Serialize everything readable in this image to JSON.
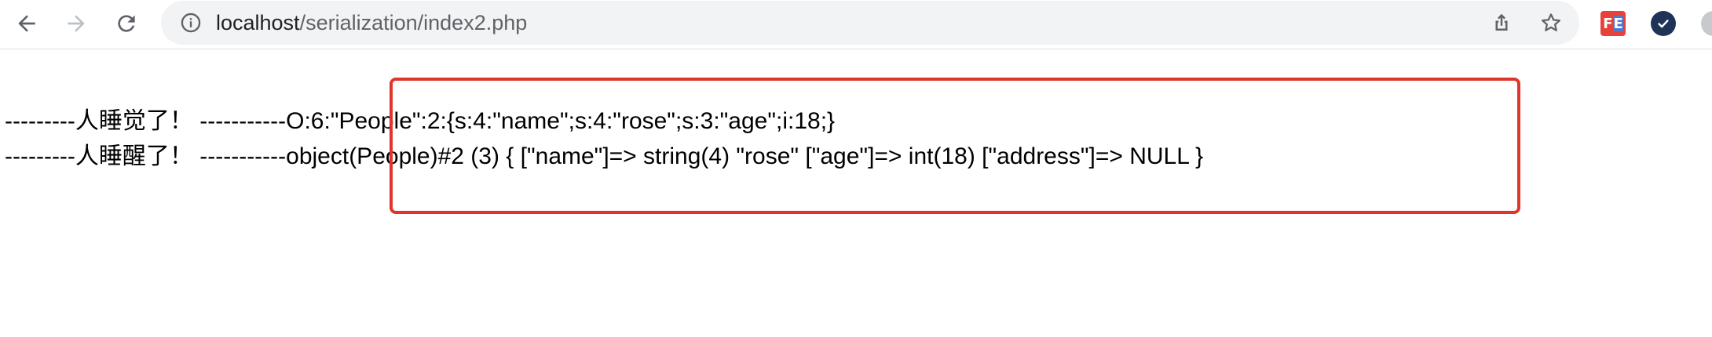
{
  "browser": {
    "url_host": "localhost",
    "url_path": "/serialization/index2.php",
    "icons": {
      "back": "arrow-left-icon",
      "forward": "arrow-right-icon",
      "reload": "reload-icon",
      "site_info": "info-icon",
      "share": "share-icon",
      "bookmark": "star-icon"
    },
    "extensions": [
      {
        "name": "fe-helper",
        "label_f": "F",
        "label_e": "E",
        "color": "#e8413a"
      },
      {
        "name": "check-extension",
        "color": "#1f3358"
      }
    ]
  },
  "page": {
    "line1_prefix": "---------人睡觉了！ -----------",
    "line1_value": "O:6:\"People\":2:{s:4:\"name\";s:4:\"rose\";s:3:\"age\";i:18;}",
    "line2_prefix": "---------人睡醒了！ -----------",
    "line2_value": "object(People)#2 (3) { [\"name\"]=> string(4) \"rose\" [\"age\"]=> int(18) [\"address\"]=> NULL }",
    "highlight_color": "#e0352b"
  }
}
